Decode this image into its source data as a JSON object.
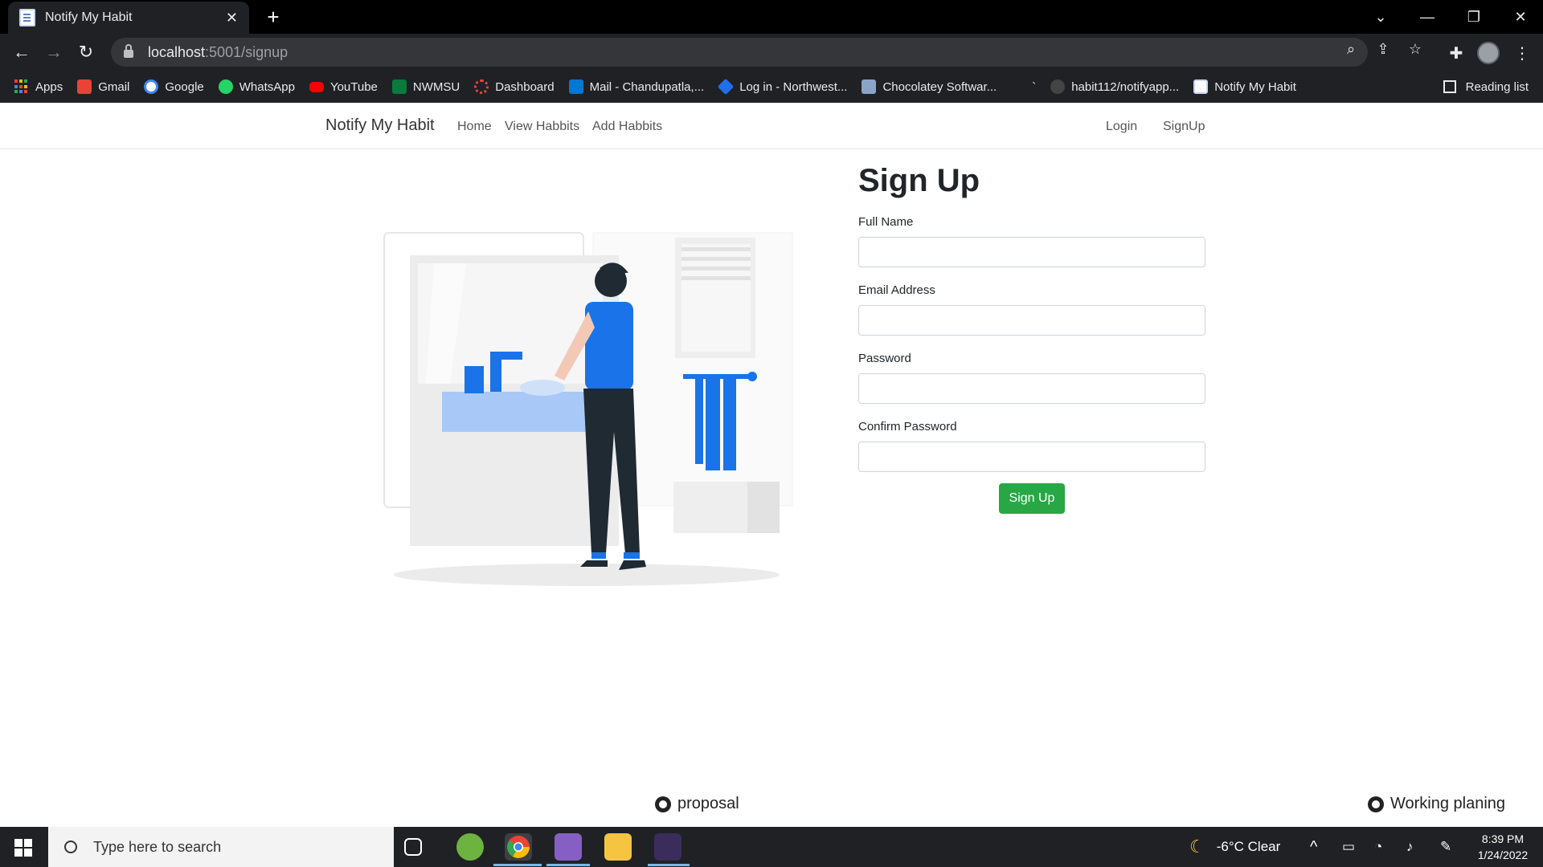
{
  "browser": {
    "tab_title": "Notify My Habit",
    "url_host": "localhost",
    "url_path": ":5001/signup",
    "bookmarks": [
      {
        "label": "Apps",
        "icon": "apps-icon",
        "color": "#4285f4"
      },
      {
        "label": "Gmail",
        "icon": "gmail-icon",
        "color": "#ea4335"
      },
      {
        "label": "Google",
        "icon": "google-icon",
        "color": "#ffffff"
      },
      {
        "label": "WhatsApp",
        "icon": "whatsapp-icon",
        "color": "#25d366"
      },
      {
        "label": "YouTube",
        "icon": "youtube-icon",
        "color": "#ff0000"
      },
      {
        "label": "NWMSU",
        "icon": "nwmsu-icon",
        "color": "#0a7a3d"
      },
      {
        "label": "Dashboard",
        "icon": "dashboard-icon",
        "color": "#e8453c"
      },
      {
        "label": "Mail - Chandupatla,...",
        "icon": "outlook-icon",
        "color": "#0078d4"
      },
      {
        "label": "Log in - Northwest...",
        "icon": "diamond-icon",
        "color": "#1f6feb"
      },
      {
        "label": "Chocolatey Softwar...",
        "icon": "chocolatey-icon",
        "color": "#8aa4c8"
      },
      {
        "label": "`",
        "icon": "blank-icon",
        "color": "#202124"
      },
      {
        "label": "habit112/notifyapp...",
        "icon": "github-icon",
        "color": "#444444"
      },
      {
        "label": "Notify My Habit",
        "icon": "page-icon",
        "color": "#c6d4f2"
      }
    ],
    "reading_list": "Reading list"
  },
  "nav": {
    "brand": "Notify My Habit",
    "home": "Home",
    "view": "View Habbits",
    "add": "Add Habbits",
    "login": "Login",
    "signup": "SignUp"
  },
  "form": {
    "title": "Sign Up",
    "fields": [
      {
        "label": "Full Name",
        "value": ""
      },
      {
        "label": "Email Address",
        "value": ""
      },
      {
        "label": "Password",
        "value": ""
      },
      {
        "label": "Confirm Password",
        "value": ""
      }
    ],
    "submit": "Sign Up"
  },
  "footer": {
    "proposal": "proposal",
    "working": "Working planing"
  },
  "taskbar": {
    "search_placeholder": "Type here to search",
    "weather": "-6°C  Clear",
    "time": "8:39 PM",
    "date": "1/24/2022"
  },
  "colors": {
    "accent_button": "#28a745",
    "illustration_blue": "#1a73e8"
  }
}
